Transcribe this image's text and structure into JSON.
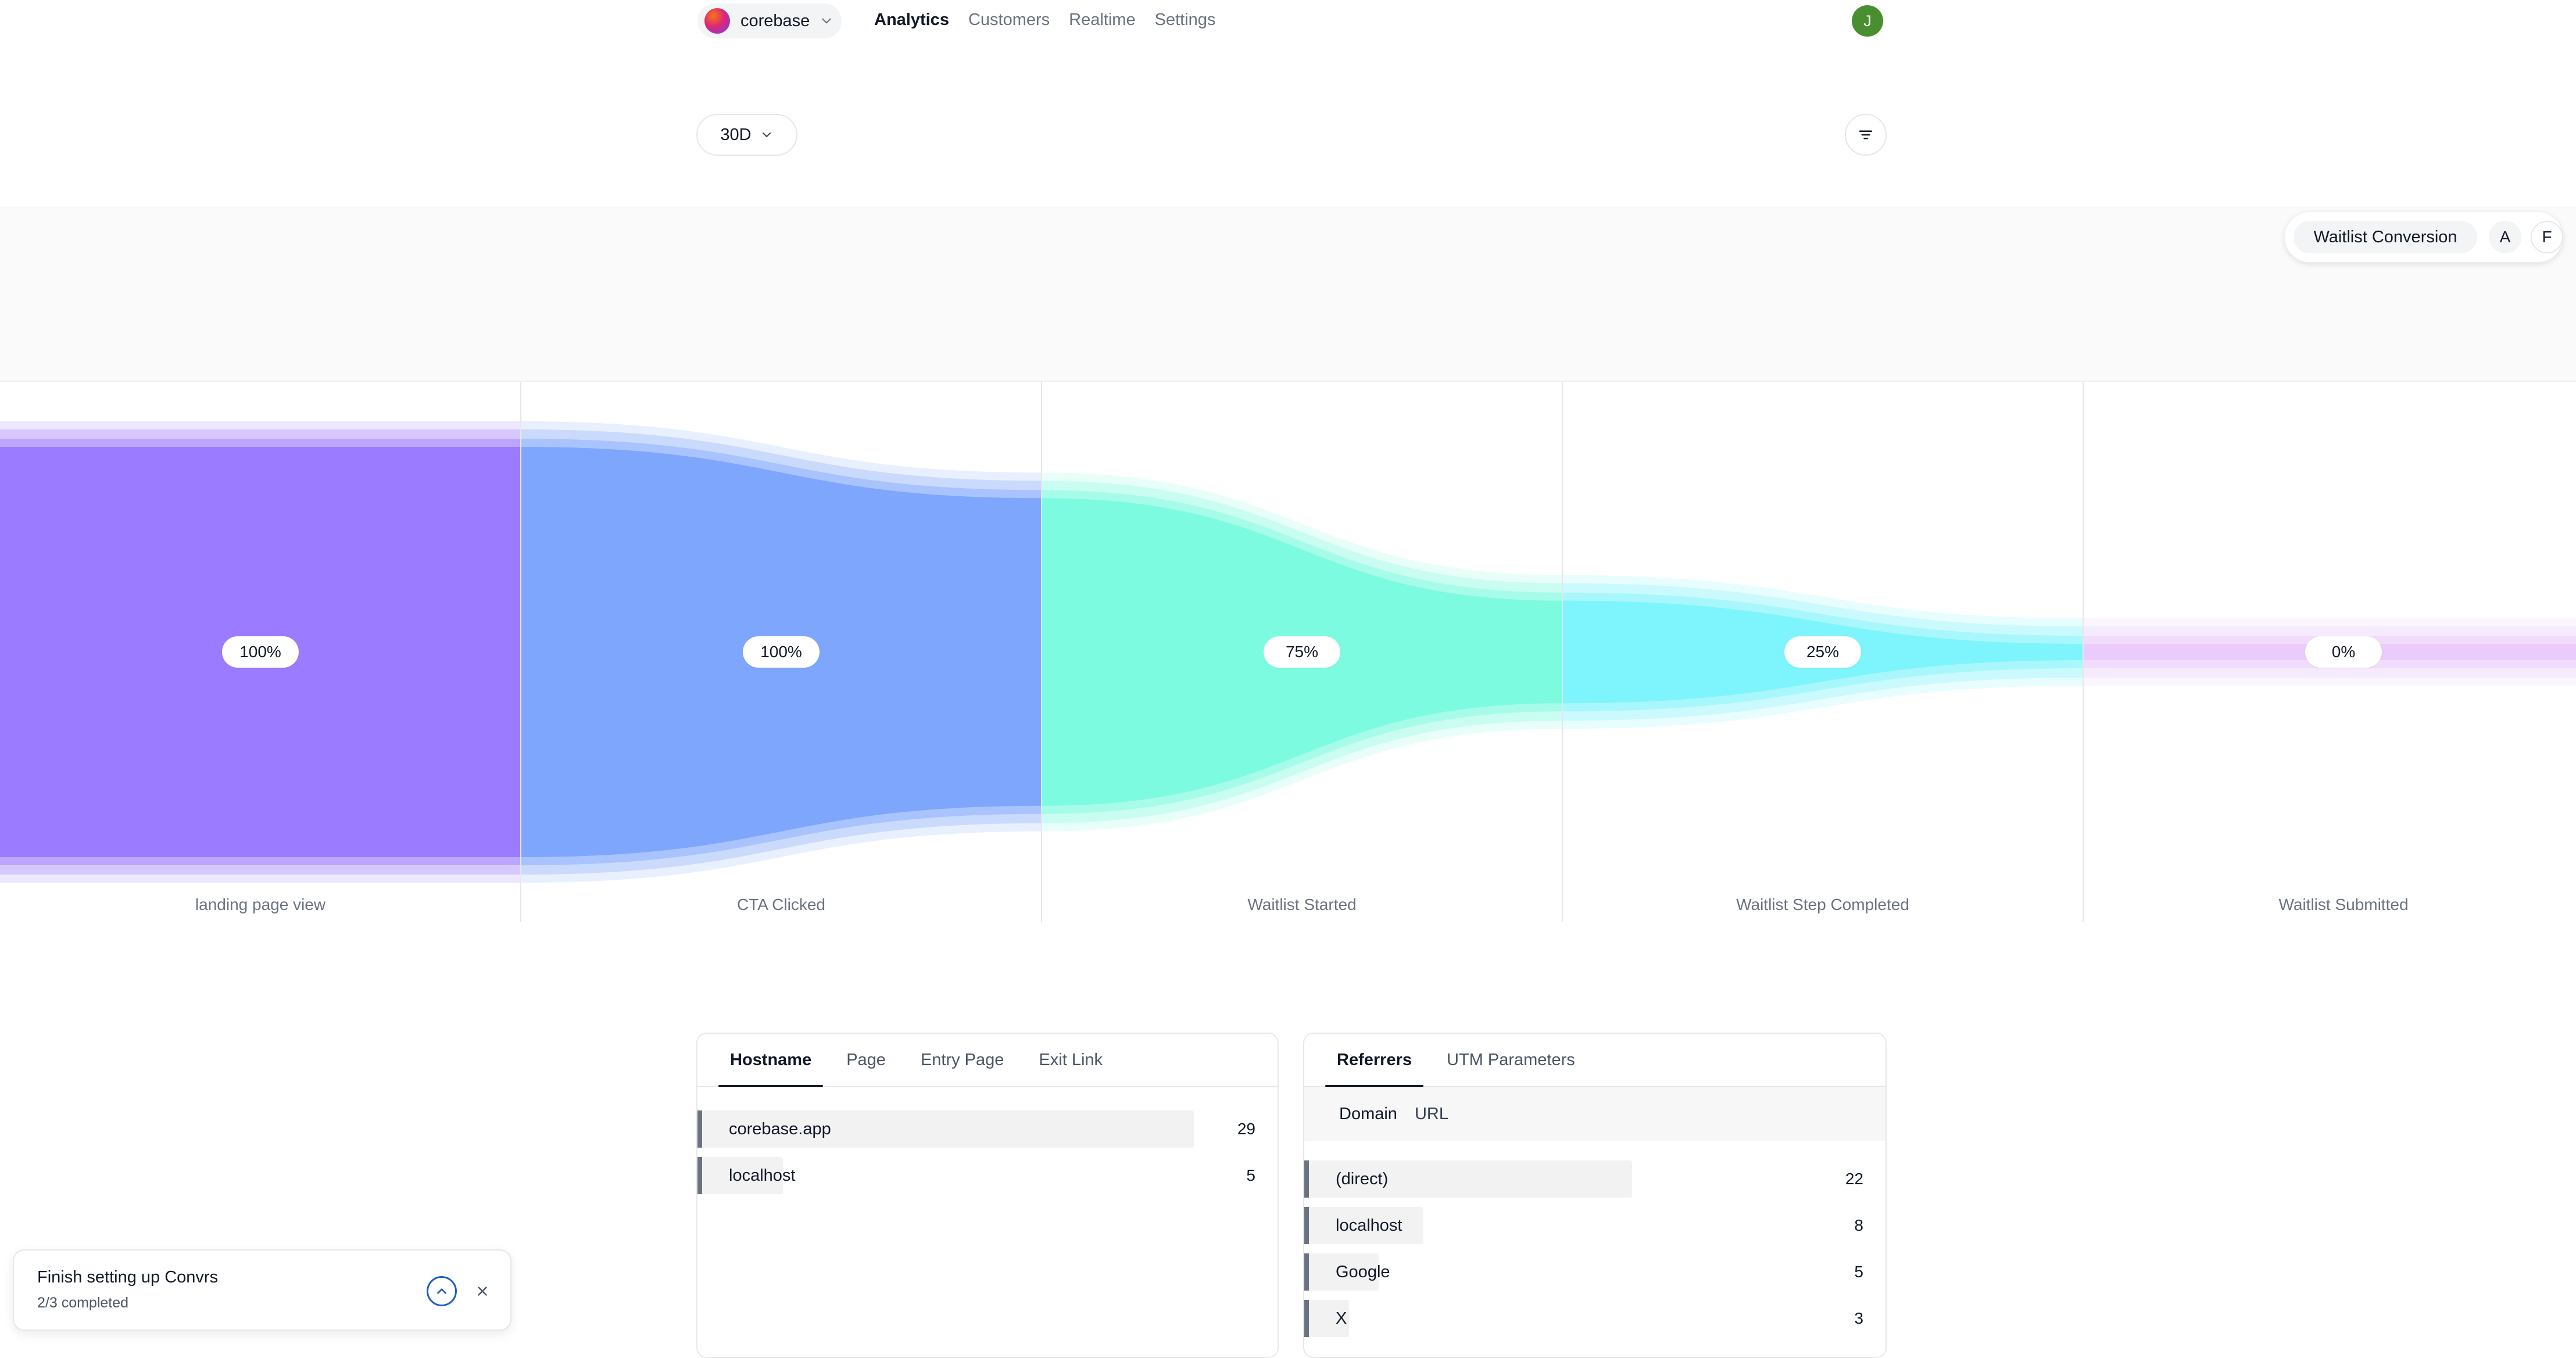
{
  "header": {
    "brand": "corebase",
    "nav": [
      "Analytics",
      "Customers",
      "Realtime",
      "Settings"
    ],
    "active_nav": "Analytics",
    "avatar_initial": "J"
  },
  "toolbar": {
    "range": "30D"
  },
  "funnel_selector": {
    "name": "Waitlist Conversion",
    "option_a": "A",
    "option_f": "F"
  },
  "funnel": {
    "steps": [
      {
        "label": "landing page view",
        "percent": "100%",
        "value": 1.0,
        "color": "#9b7bff"
      },
      {
        "label": "CTA Clicked",
        "percent": "100%",
        "value": 1.0,
        "color": "#7ea6fc"
      },
      {
        "label": "Waitlist Started",
        "percent": "75%",
        "value": 0.75,
        "color": "#7dfbe0"
      },
      {
        "label": "Waitlist Step Completed",
        "percent": "25%",
        "value": 0.25,
        "color": "#7ef5fc"
      },
      {
        "label": "Waitlist Submitted",
        "percent": "0%",
        "value": 0.0,
        "color": "#eacbfb"
      }
    ]
  },
  "pages_panel": {
    "tabs": [
      "Hostname",
      "Page",
      "Entry Page",
      "Exit Link"
    ],
    "active_tab": "Hostname",
    "rows": [
      {
        "label": "corebase.app",
        "count": "29",
        "value": 29
      },
      {
        "label": "localhost",
        "count": "5",
        "value": 5
      }
    ]
  },
  "sources_panel": {
    "tabs": [
      "Referrers",
      "UTM Parameters"
    ],
    "active_tab": "Referrers",
    "subtabs": [
      "Domain",
      "URL"
    ],
    "rows": [
      {
        "label": "(direct)",
        "count": "22",
        "value": 22
      },
      {
        "label": "localhost",
        "count": "8",
        "value": 8
      },
      {
        "label": "Google",
        "count": "5",
        "value": 5
      },
      {
        "label": "X",
        "count": "3",
        "value": 3
      }
    ]
  },
  "toast": {
    "title": "Finish setting up Convrs",
    "subtitle": "2/3 completed"
  },
  "icons": {
    "brand_chevron": "chevron-down-icon",
    "range_chevron": "chevron-down-icon",
    "filter": "filter-icon",
    "toast_expand": "chevron-up-circle-icon",
    "toast_close": "close-icon"
  }
}
